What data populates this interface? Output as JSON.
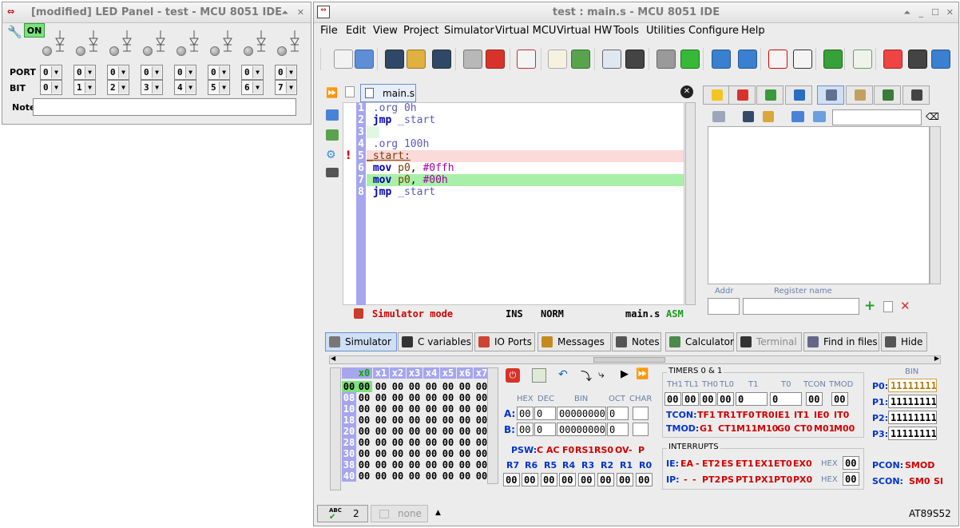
{
  "led_window": {
    "title": "[modified] LED Panel - test - MCU 8051 IDE",
    "on_label": "ON",
    "port_label": "PORT",
    "bit_label": "BIT",
    "note_label": "Note",
    "note_value": "",
    "ports": [
      "0",
      "0",
      "0",
      "0",
      "0",
      "0",
      "0",
      "0"
    ],
    "bits": [
      "0",
      "1",
      "2",
      "3",
      "4",
      "5",
      "6",
      "7"
    ]
  },
  "main_window": {
    "title": "test : main.s - MCU 8051 IDE",
    "menu": [
      "File",
      "Edit",
      "View",
      "Project",
      "Simulator",
      "Virtual MCU",
      "Virtual HW",
      "Tools",
      "Utilities",
      "Configure",
      "Help"
    ]
  },
  "editor": {
    "tab_label": "main.s",
    "lines": [
      {
        "n": "1",
        "code": " .org 0h"
      },
      {
        "n": "2",
        "code": " jmp _start"
      },
      {
        "n": "3",
        "code": ""
      },
      {
        "n": "4",
        "code": " .org 100h"
      },
      {
        "n": "5",
        "code": "_start:"
      },
      {
        "n": "6",
        "code": " mov p0, #0ffh"
      },
      {
        "n": "7",
        "code": " mov p0, #00h"
      },
      {
        "n": "8",
        "code": " jmp _start"
      }
    ],
    "status": {
      "mode": "Simulator mode",
      "ins": "INS",
      "norm": "NORM",
      "file": "main.s",
      "lang": "ASM"
    }
  },
  "right_panel": {
    "addr_label": "Addr",
    "regname_label": "Register name",
    "search_value": ""
  },
  "bottom_tabs": [
    "Simulator",
    "C variables",
    "IO Ports",
    "Messages",
    "Notes",
    "Calculator",
    "Terminal",
    "Find in files",
    "Hide"
  ],
  "hex": {
    "cols": [
      "x0",
      "x1",
      "x2",
      "x3",
      "x4",
      "x5",
      "x6",
      "x7"
    ],
    "rows": [
      {
        "addr": "00",
        "vals": [
          "00",
          "00",
          "00",
          "00",
          "00",
          "00",
          "00",
          "00"
        ]
      },
      {
        "addr": "08",
        "vals": [
          "00",
          "00",
          "00",
          "00",
          "00",
          "00",
          "00",
          "00"
        ]
      },
      {
        "addr": "10",
        "vals": [
          "00",
          "00",
          "00",
          "00",
          "00",
          "00",
          "00",
          "00"
        ]
      },
      {
        "addr": "18",
        "vals": [
          "00",
          "00",
          "00",
          "00",
          "00",
          "00",
          "00",
          "00"
        ]
      },
      {
        "addr": "20",
        "vals": [
          "00",
          "00",
          "00",
          "00",
          "00",
          "00",
          "00",
          "00"
        ]
      },
      {
        "addr": "28",
        "vals": [
          "00",
          "00",
          "00",
          "00",
          "00",
          "00",
          "00",
          "00"
        ]
      },
      {
        "addr": "30",
        "vals": [
          "00",
          "00",
          "00",
          "00",
          "00",
          "00",
          "00",
          "00"
        ]
      },
      {
        "addr": "38",
        "vals": [
          "00",
          "00",
          "00",
          "00",
          "00",
          "00",
          "00",
          "00"
        ]
      },
      {
        "addr": "40",
        "vals": [
          "00",
          "00",
          "00",
          "00",
          "00",
          "00",
          "00",
          "00"
        ]
      }
    ]
  },
  "regs": {
    "hdr_hex": "HEX",
    "hdr_dec": "DEC",
    "hdr_bin": "BIN",
    "hdr_oct": "OCT",
    "hdr_char": "CHAR",
    "a_label": "A:",
    "a_hex": "00",
    "a_dec": "0",
    "a_bin": "00000000",
    "a_oct": "0",
    "a_char": "",
    "b_label": "B:",
    "b_hex": "00",
    "b_dec": "0",
    "b_bin": "00000000",
    "b_oct": "0",
    "b_char": "",
    "psw_label": "PSW:",
    "psw_bits": [
      "C",
      "AC",
      "F0",
      "RS1",
      "RS0",
      "OV",
      "-",
      "P"
    ],
    "r_labels": [
      "R7",
      "R6",
      "R5",
      "R4",
      "R3",
      "R2",
      "R1",
      "R0"
    ],
    "r_vals": [
      "00",
      "00",
      "00",
      "00",
      "00",
      "00",
      "00",
      "00"
    ]
  },
  "timers": {
    "title": "TIMERS 0 & 1",
    "hdrs": [
      "TH1",
      "TL1",
      "TH0",
      "TL0",
      "T1",
      "T0",
      "TCON",
      "TMOD"
    ],
    "vals": [
      "00",
      "00",
      "00",
      "00",
      "0",
      "0",
      "00",
      "00"
    ],
    "tcon_label": "TCON:",
    "tcon_bits": [
      "TF1",
      "TR1",
      "TF0",
      "TR0",
      "IE1",
      "IT1",
      "IE0",
      "IT0"
    ],
    "tmod_label": "TMOD:",
    "tmod_bits": [
      "G1",
      "CT1",
      "M11",
      "M10",
      "G0",
      "CT0",
      "M01",
      "M00"
    ]
  },
  "interrupts": {
    "title": "INTERRUPTS",
    "ie_label": "IE:",
    "ie_bits": [
      "EA",
      "-",
      "ET2",
      "ES",
      "ET1",
      "EX1",
      "ET0",
      "EX0"
    ],
    "ie_hex_label": "HEX",
    "ie_hex": "00",
    "ip_label": "IP:",
    "ip_bits": [
      "-",
      "-",
      "PT2",
      "PS",
      "PT1",
      "PX1",
      "PT0",
      "PX0"
    ],
    "ip_hex_label": "HEX",
    "ip_hex": "00"
  },
  "ports_panel": {
    "bin_label": "BIN",
    "ports": [
      {
        "label": "P0:",
        "val": "11111111"
      },
      {
        "label": "P1:",
        "val": "11111111"
      },
      {
        "label": "P2:",
        "val": "11111111"
      },
      {
        "label": "P3:",
        "val": "11111111"
      }
    ],
    "pcon_label": "PCON:",
    "pcon_val": "SMOD",
    "scon_label": "SCON:",
    "scon_val": "SM0",
    "scon_val2": "SI"
  },
  "statusbar": {
    "count": "2",
    "none_label": "none",
    "mcu": "AT89S52"
  }
}
